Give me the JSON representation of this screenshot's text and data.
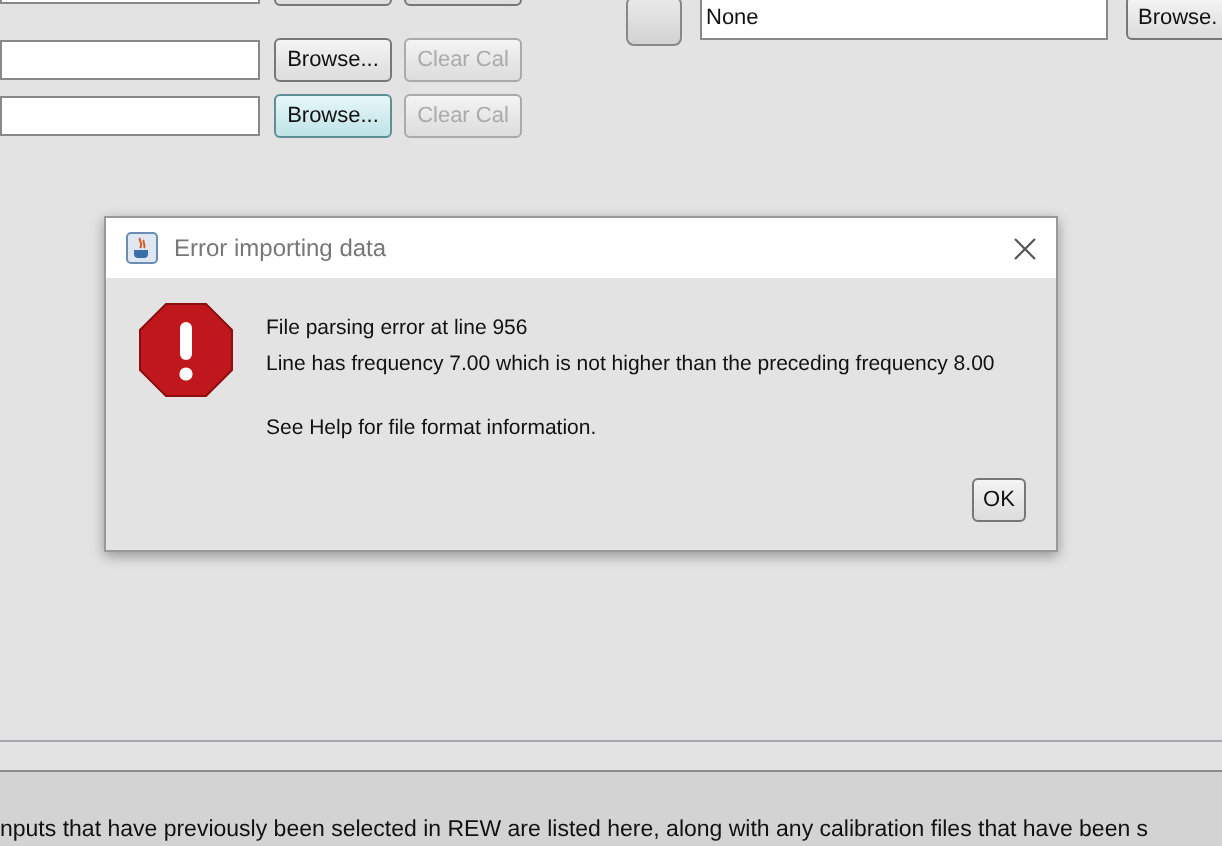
{
  "device_row": {
    "value": "None",
    "browse": "Browse."
  },
  "cal_rows": [
    {
      "browse": "Browse...",
      "browse_hovered": false,
      "clear": "Clear Cal",
      "clear_disabled": true
    },
    {
      "browse": "Browse...",
      "browse_hovered": true,
      "clear": "Clear Cal",
      "clear_disabled": true
    }
  ],
  "dialog": {
    "title": "Error importing data",
    "lines": [
      "File parsing error at line 956",
      "Line has frequency 7.00 which is not higher than the preceding frequency 8.00"
    ],
    "note": "See Help for file format information.",
    "ok": "OK"
  },
  "help_text": "nputs that have previously been selected in REW are listed here, along with any calibration files that have been s"
}
